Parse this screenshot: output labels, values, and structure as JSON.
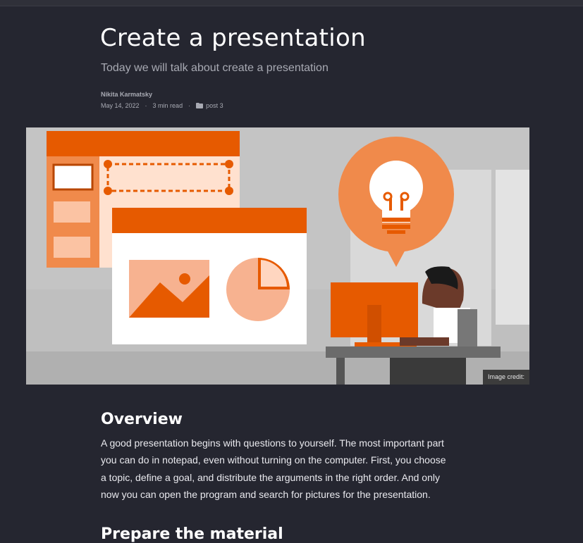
{
  "post": {
    "title": "Create a presentation",
    "subtitle": "Today we will talk about create a presentation",
    "author": "Nikita Karmatsky",
    "date": "May 14, 2022",
    "separator": "·",
    "read_time": "3 min read",
    "category": "post 3",
    "category_icon": "folder-icon"
  },
  "hero_image": {
    "credit": "Image credit:",
    "colors": {
      "orange": "#e65a00",
      "light_orange": "#f08a4b",
      "peach": "#f7b290",
      "gray_bg": "#bdbdbd",
      "light_gray": "#d6d6d6"
    }
  },
  "content": {
    "section_title": "Overview",
    "paragraph": "A good presentation begins with questions to yourself. The most important part you can do in notepad, even without turning on the computer. First, you choose a topic, define a goal, and distribute the arguments in the right order. And only now you can open the program and search for pictures for the presentation.",
    "next_section_title": "Prepare the material"
  }
}
